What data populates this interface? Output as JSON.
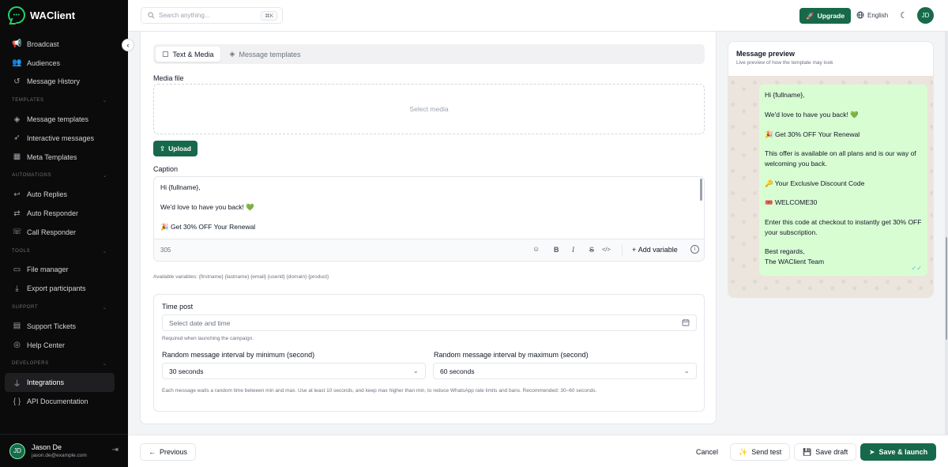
{
  "brand": {
    "name": "WAClient",
    "logo_dots": "•••"
  },
  "sidebar": {
    "items_top": [
      {
        "label": "Broadcast",
        "icon": "megaphone-icon",
        "glyph": "📢"
      },
      {
        "label": "Audiences",
        "icon": "users-icon",
        "glyph": "👥"
      },
      {
        "label": "Message History",
        "icon": "history-icon",
        "glyph": "↺"
      }
    ],
    "sections": [
      {
        "title": "TEMPLATES",
        "items": [
          {
            "label": "Message templates",
            "icon": "layers-icon",
            "glyph": "◈"
          },
          {
            "label": "Interactive messages",
            "icon": "pointer-icon",
            "glyph": "➶"
          },
          {
            "label": "Meta Templates",
            "icon": "layout-icon",
            "glyph": "▦"
          }
        ]
      },
      {
        "title": "AUTOMATIONS",
        "items": [
          {
            "label": "Auto Replies",
            "icon": "reply-icon",
            "glyph": "↩"
          },
          {
            "label": "Auto Responder",
            "icon": "arrows-icon",
            "glyph": "⇄"
          },
          {
            "label": "Call Responder",
            "icon": "phone-icon",
            "glyph": "☏"
          }
        ]
      },
      {
        "title": "TOOLS",
        "items": [
          {
            "label": "File manager",
            "icon": "folder-icon",
            "glyph": "▭"
          },
          {
            "label": "Export participants",
            "icon": "download-icon",
            "glyph": "⤓"
          }
        ]
      },
      {
        "title": "SUPPORT",
        "items": [
          {
            "label": "Support Tickets",
            "icon": "ticket-icon",
            "glyph": "▤"
          },
          {
            "label": "Help Center",
            "icon": "lifebuoy-icon",
            "glyph": "◎"
          }
        ]
      },
      {
        "title": "DEVELOPERS",
        "items": [
          {
            "label": "Integrations",
            "icon": "plug-icon",
            "glyph": "⏚",
            "active": true
          },
          {
            "label": "API Documentation",
            "icon": "braces-icon",
            "glyph": "{ }"
          }
        ]
      }
    ],
    "section_chevron": "⌄",
    "user": {
      "initials": "JD",
      "name": "Jason De",
      "email": "jason.de@example.com",
      "logout_glyph": "⇥"
    },
    "collapse_glyph": "‹"
  },
  "header": {
    "search_placeholder": "Search anything...",
    "search_shortcut": "⌘K",
    "upgrade_label": "Upgrade",
    "language": "English",
    "avatar_initials": "JD"
  },
  "form": {
    "tabs": [
      {
        "label": "Text & Media",
        "icon": "message-square-icon",
        "glyph": "▢",
        "active": true
      },
      {
        "label": "Message templates",
        "icon": "layers-icon",
        "glyph": "◈",
        "active": false
      }
    ],
    "media_label": "Media file",
    "dropzone_text": "Select media",
    "upload_label": "Upload",
    "caption_label": "Caption",
    "caption_lines": [
      "Hi {fullname},",
      "We'd love to have you back! 💚",
      "🎉 Get 30% OFF Your Renewal"
    ],
    "char_count": "305",
    "toolbar": {
      "emoji": "☺",
      "bold": "B",
      "italic": "I",
      "strike": "S",
      "code": "</>",
      "add_variable": "Add variable",
      "info": "i"
    },
    "available_vars": "Available variables: {firstname} {lastname} {email} {userid} {domain} {product}",
    "schedule": {
      "time_label": "Time post",
      "time_placeholder": "Select date and time",
      "time_hint": "Required when launching the campaign.",
      "min_label": "Random message interval by minimum (second)",
      "min_value": "30 seconds",
      "max_label": "Random message interval by maximum (second)",
      "max_value": "60 seconds",
      "interval_hint": "Each message waits a random time between min and max. Use at least 10 seconds, and keep max higher than min, to reduce WhatsApp rate limits and bans. Recommended: 30–60 seconds."
    }
  },
  "preview": {
    "title": "Message preview",
    "subtitle": "Live preview of how the template may look",
    "lines": [
      "Hi {fullname},",
      "We'd love to have you back! 💚",
      "🎉 Get 30% OFF Your Renewal",
      "This offer is available on all plans and is our way of welcoming you back.",
      "🔑 Your Exclusive Discount Code",
      "🎟️ WELCOME30",
      "Enter this code at checkout to instantly get 30% OFF your subscription.",
      "Best regards,",
      "The WAClient Team"
    ],
    "ticks": "✓✓"
  },
  "footer": {
    "previous_label": "Previous",
    "cancel_label": "Cancel",
    "send_test_label": "Send test",
    "save_draft_label": "Save draft",
    "save_launch_label": "Save & launch"
  },
  "colors": {
    "brand_green": "#17694b",
    "whatsapp_green": "#25d366",
    "bubble": "#d9fdd3",
    "sidebar_bg": "#0b0b0c"
  }
}
